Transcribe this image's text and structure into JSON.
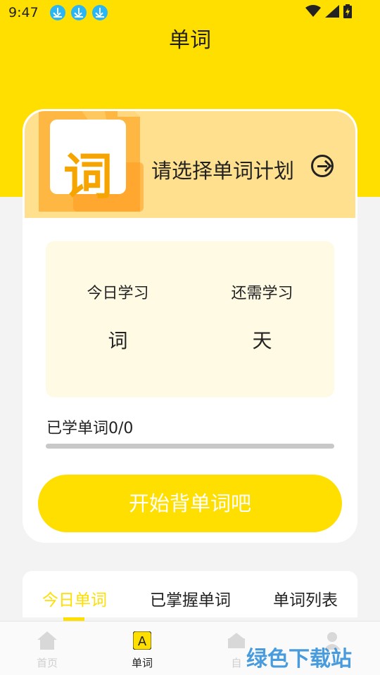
{
  "status_bar": {
    "time": "9:47"
  },
  "header": {
    "title": "单词"
  },
  "plan": {
    "label": "请选择单词计划",
    "logo_char": "词"
  },
  "stats": {
    "today_label": "今日学习",
    "today_unit": "词",
    "remain_label": "还需学习",
    "remain_unit": "天"
  },
  "progress": {
    "label": "已学单词0/0",
    "fraction": 0
  },
  "start_button": {
    "label": "开始背单词吧"
  },
  "tabs": [
    {
      "label": "今日单词",
      "active": true
    },
    {
      "label": "已掌握单词",
      "active": false
    },
    {
      "label": "单词列表",
      "active": false
    }
  ],
  "bottom_nav": [
    {
      "label": "首页",
      "icon": "home-icon",
      "active": false
    },
    {
      "label": "单词",
      "icon": "word-a-icon",
      "active": true
    },
    {
      "label": "自",
      "icon": "study-icon",
      "active": false
    },
    {
      "label": "",
      "icon": "user-icon",
      "active": false
    }
  ],
  "watermark": {
    "text": "绿色下载站"
  },
  "colors": {
    "accent": "#fedf00",
    "banner": "#ffe08f",
    "stats_bg": "#fefae4"
  }
}
